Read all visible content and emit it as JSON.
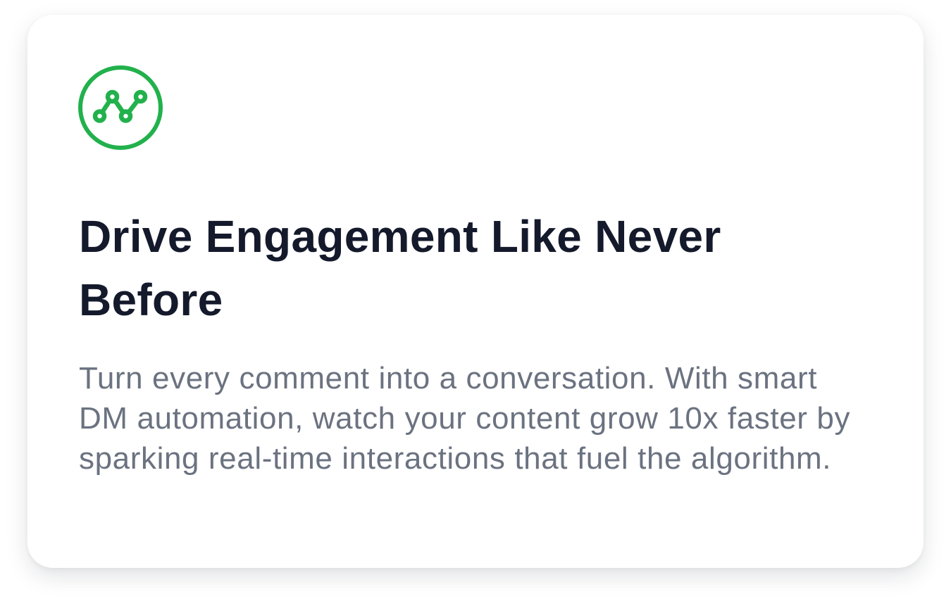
{
  "card": {
    "icon": "trend-line-circle-icon",
    "title": "Drive Engagement Like Never Before",
    "description": "Turn every comment into a conversation. With smart DM automation, watch your content grow 10x faster by sparking real-time interactions that fuel the algorithm."
  },
  "colors": {
    "accent": "#22b14c",
    "title": "#141a2b",
    "body": "#6b7280",
    "background": "#ffffff"
  }
}
